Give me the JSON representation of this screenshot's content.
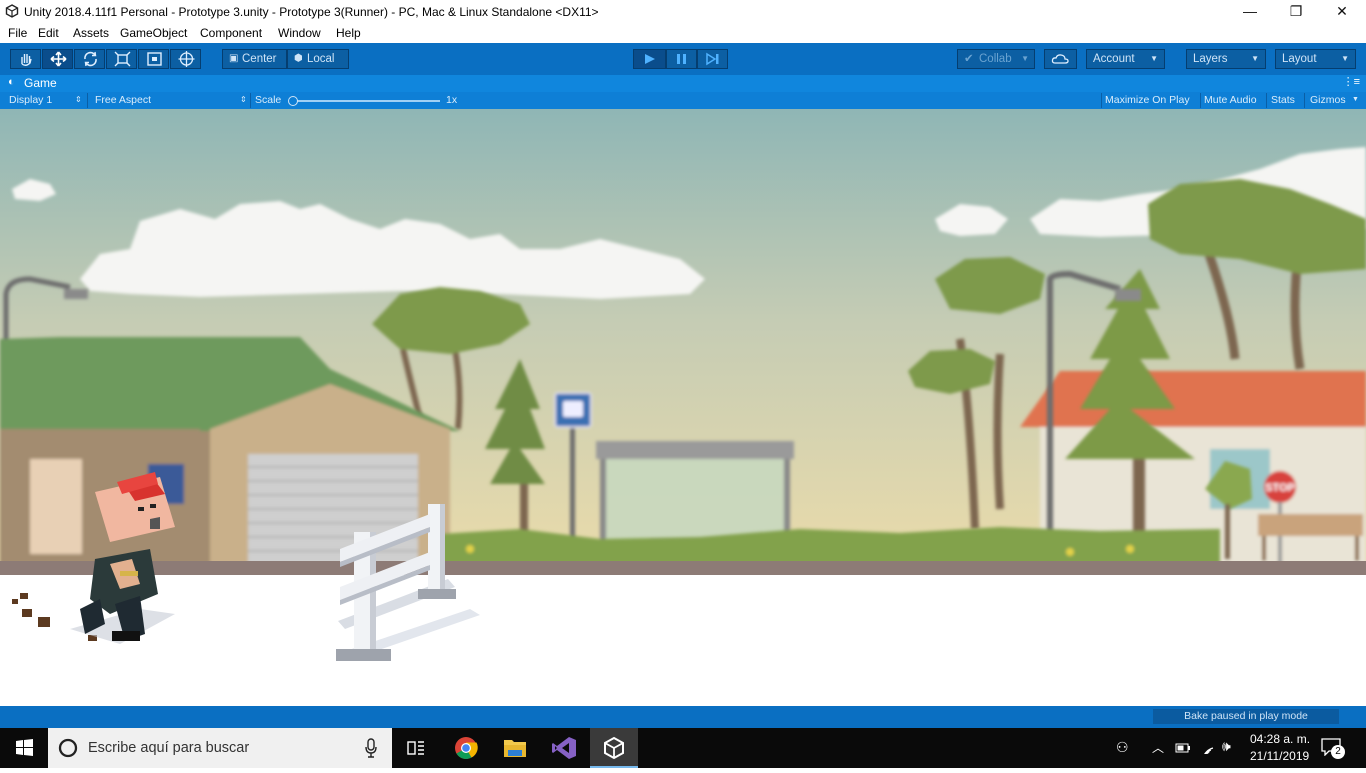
{
  "window": {
    "title": "Unity 2018.4.11f1 Personal - Prototype 3.unity - Prototype 3(Runner) - PC, Mac & Linux Standalone <DX11>",
    "minimize_glyph": "—",
    "restore_glyph": "❐",
    "close_glyph": "✕"
  },
  "menu": {
    "items": [
      "File",
      "Edit",
      "Assets",
      "GameObject",
      "Component",
      "Window",
      "Help"
    ]
  },
  "toolbar": {
    "tools": [
      "hand-tool",
      "move-tool",
      "rotate-tool",
      "scale-tool",
      "rect-tool",
      "transform-tool"
    ],
    "pivot_label": "Center",
    "space_label": "Local",
    "collab_label": "Collab",
    "account_label": "Account",
    "layers_label": "Layers",
    "layout_label": "Layout"
  },
  "game_tab": {
    "label": "Game",
    "display": "Display 1",
    "aspect": "Free Aspect",
    "scale_label": "Scale",
    "scale_value": "1x",
    "maximize": "Maximize On Play",
    "mute": "Mute Audio",
    "stats": "Stats",
    "gizmos": "Gizmos"
  },
  "scene": {
    "stop_sign": "STOP"
  },
  "status": {
    "bake": "Bake paused in play mode"
  },
  "taskbar": {
    "search_placeholder": "Escribe aquí para buscar",
    "time": "04:28 a. m.",
    "date": "21/11/2019",
    "notifications": "2"
  },
  "colors": {
    "unity_blue": "#0a6fc2",
    "tab_blue": "#1086dd",
    "sky_top": "#90b8b6",
    "sky_bottom": "#e8dcb0",
    "ground": "#ffffff"
  }
}
